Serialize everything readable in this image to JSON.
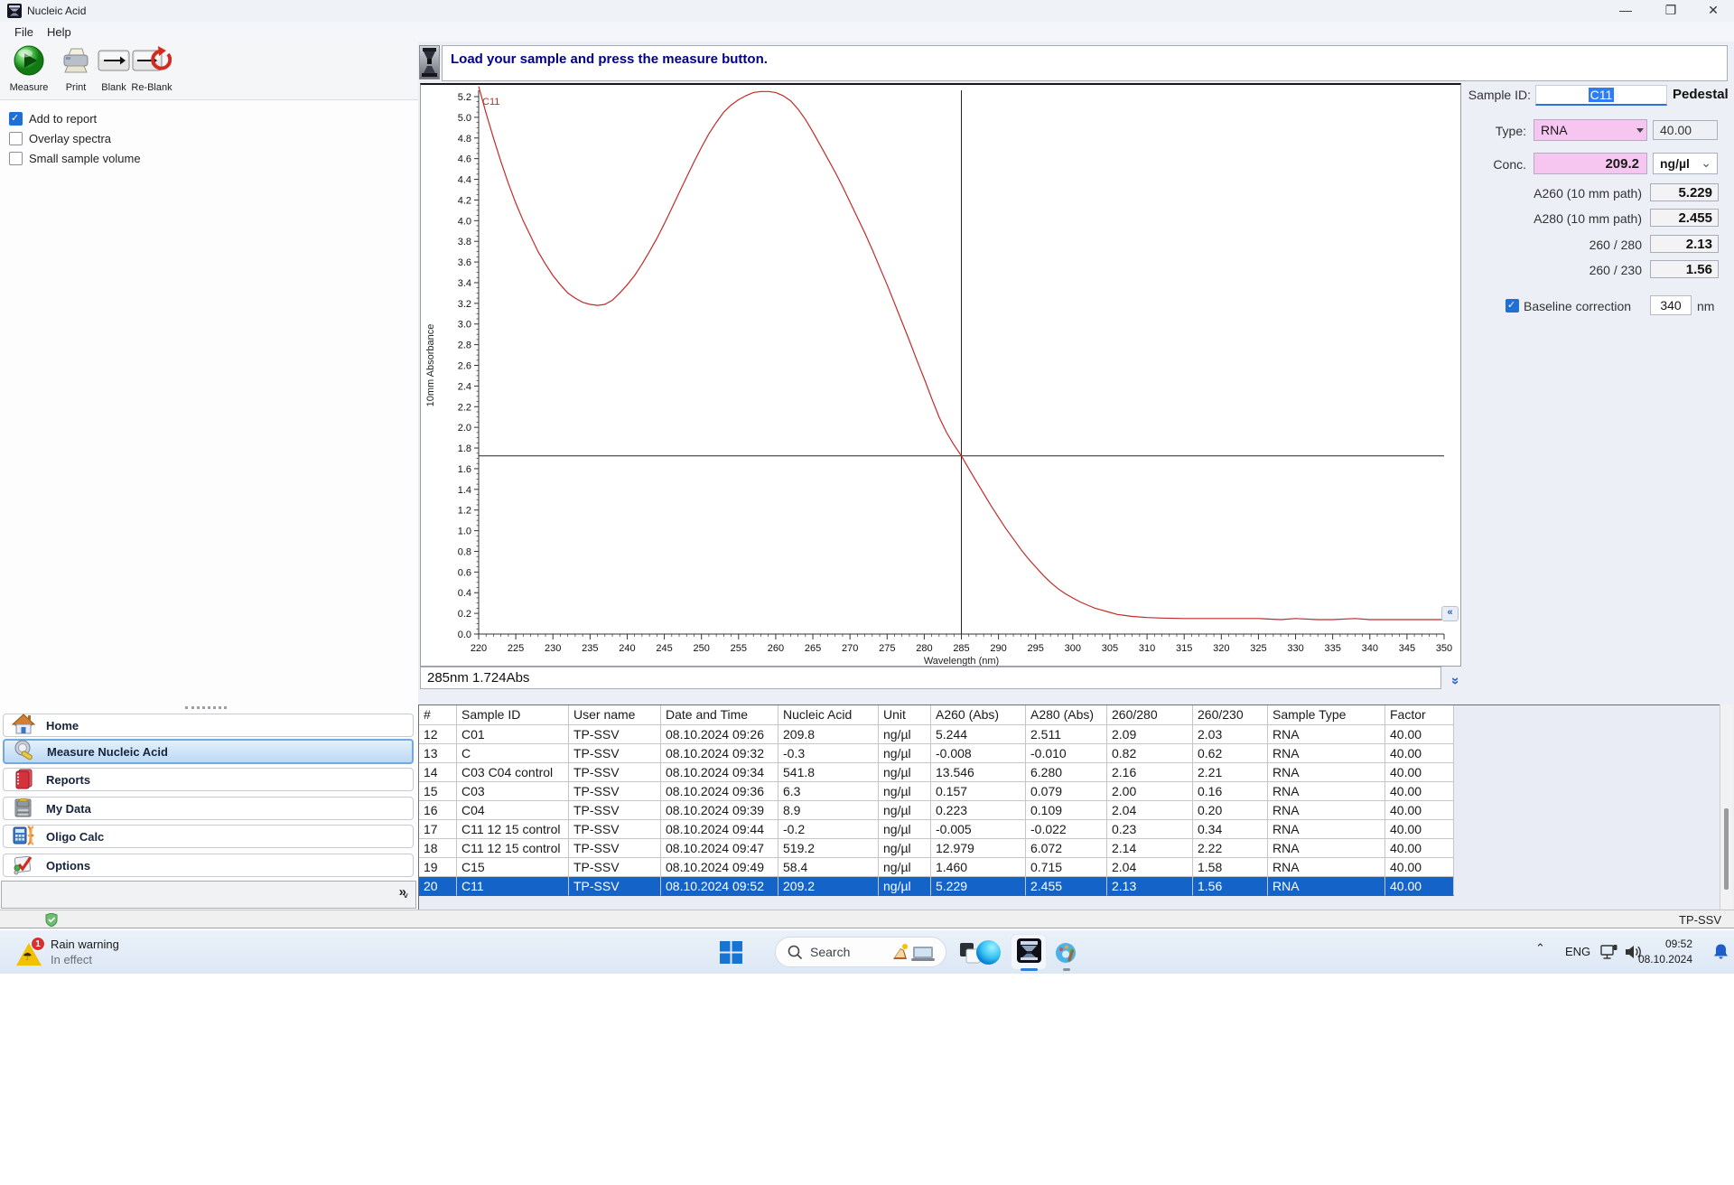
{
  "window": {
    "title": "Nucleic Acid"
  },
  "menu": {
    "items": [
      "File",
      "Help"
    ]
  },
  "toolbar": {
    "buttons": [
      {
        "label": "Measure",
        "icon": "measure-icon"
      },
      {
        "label": "Print",
        "icon": "print-icon"
      },
      {
        "label": "Blank",
        "icon": "blank-icon"
      },
      {
        "label": "Re-Blank",
        "icon": "reblank-icon"
      }
    ]
  },
  "report_options": {
    "checkboxes": [
      {
        "label": "Add to report",
        "checked": true
      },
      {
        "label": "Overlay spectra",
        "checked": false
      },
      {
        "label": "Small sample volume",
        "checked": false
      }
    ]
  },
  "status_message": "Load your sample and press the measure button.",
  "readout": "285nm 1.724Abs",
  "chart_data": {
    "type": "line",
    "xlabel": "Wavelength (nm)",
    "ylabel": "10mm Absorbance",
    "xlim": [
      220,
      350
    ],
    "ylim": [
      0,
      5.2
    ],
    "x_major_step": 5,
    "y_major_step": 0.2,
    "grid": false,
    "cursor": {
      "x": 285,
      "y": 1.724
    },
    "series": [
      {
        "name": "C11",
        "color": "#c22a2a",
        "points": [
          [
            220,
            5.3
          ],
          [
            221,
            5.04
          ],
          [
            222,
            4.8
          ],
          [
            223,
            4.57
          ],
          [
            224,
            4.36
          ],
          [
            225,
            4.17
          ],
          [
            226,
            4.0
          ],
          [
            227,
            3.85
          ],
          [
            228,
            3.7
          ],
          [
            229,
            3.58
          ],
          [
            230,
            3.47
          ],
          [
            231,
            3.38
          ],
          [
            232,
            3.3
          ],
          [
            233,
            3.25
          ],
          [
            234,
            3.21
          ],
          [
            235,
            3.19
          ],
          [
            236,
            3.18
          ],
          [
            237,
            3.19
          ],
          [
            238,
            3.23
          ],
          [
            239,
            3.3
          ],
          [
            240,
            3.38
          ],
          [
            241,
            3.47
          ],
          [
            242,
            3.58
          ],
          [
            243,
            3.7
          ],
          [
            244,
            3.83
          ],
          [
            245,
            3.97
          ],
          [
            246,
            4.12
          ],
          [
            247,
            4.27
          ],
          [
            248,
            4.42
          ],
          [
            249,
            4.57
          ],
          [
            250,
            4.71
          ],
          [
            251,
            4.84
          ],
          [
            252,
            4.95
          ],
          [
            253,
            5.05
          ],
          [
            254,
            5.12
          ],
          [
            255,
            5.17
          ],
          [
            256,
            5.21
          ],
          [
            257,
            5.24
          ],
          [
            258,
            5.25
          ],
          [
            259,
            5.25
          ],
          [
            260,
            5.24
          ],
          [
            261,
            5.21
          ],
          [
            262,
            5.16
          ],
          [
            263,
            5.08
          ],
          [
            264,
            4.98
          ],
          [
            265,
            4.86
          ],
          [
            266,
            4.73
          ],
          [
            267,
            4.6
          ],
          [
            268,
            4.47
          ],
          [
            269,
            4.33
          ],
          [
            270,
            4.18
          ],
          [
            271,
            4.03
          ],
          [
            272,
            3.88
          ],
          [
            273,
            3.72
          ],
          [
            274,
            3.55
          ],
          [
            275,
            3.38
          ],
          [
            276,
            3.2
          ],
          [
            277,
            3.02
          ],
          [
            278,
            2.84
          ],
          [
            279,
            2.65
          ],
          [
            280,
            2.47
          ],
          [
            281,
            2.28
          ],
          [
            282,
            2.1
          ],
          [
            283,
            1.95
          ],
          [
            284,
            1.83
          ],
          [
            285,
            1.724
          ],
          [
            286,
            1.6
          ],
          [
            287,
            1.48
          ],
          [
            288,
            1.36
          ],
          [
            289,
            1.24
          ],
          [
            290,
            1.13
          ],
          [
            291,
            1.02
          ],
          [
            292,
            0.92
          ],
          [
            293,
            0.82
          ],
          [
            294,
            0.73
          ],
          [
            295,
            0.65
          ],
          [
            296,
            0.57
          ],
          [
            297,
            0.5
          ],
          [
            298,
            0.44
          ],
          [
            299,
            0.39
          ],
          [
            300,
            0.35
          ],
          [
            301,
            0.31
          ],
          [
            302,
            0.28
          ],
          [
            303,
            0.25
          ],
          [
            304,
            0.23
          ],
          [
            305,
            0.21
          ],
          [
            306,
            0.19
          ],
          [
            307,
            0.18
          ],
          [
            308,
            0.17
          ],
          [
            310,
            0.16
          ],
          [
            312,
            0.155
          ],
          [
            315,
            0.15
          ],
          [
            318,
            0.15
          ],
          [
            320,
            0.15
          ],
          [
            323,
            0.15
          ],
          [
            325,
            0.15
          ],
          [
            328,
            0.14
          ],
          [
            330,
            0.15
          ],
          [
            333,
            0.14
          ],
          [
            335,
            0.14
          ],
          [
            338,
            0.15
          ],
          [
            340,
            0.14
          ],
          [
            343,
            0.14
          ],
          [
            345,
            0.14
          ],
          [
            348,
            0.14
          ],
          [
            350,
            0.14
          ]
        ]
      }
    ]
  },
  "sample_panel": {
    "sample_id_label": "Sample ID:",
    "sample_id": "C11",
    "mode": "Pedestal",
    "type_label": "Type:",
    "type_value": "RNA",
    "type_factor": "40.00",
    "conc_label": "Conc.",
    "conc_value": "209.2",
    "conc_unit": "ng/µl",
    "rows": [
      {
        "label": "A260 (10 mm path)",
        "value": "5.229"
      },
      {
        "label": "A280 (10 mm path)",
        "value": "2.455"
      },
      {
        "label": "260 / 280",
        "value": "2.13"
      },
      {
        "label": "260 / 230",
        "value": "1.56"
      }
    ],
    "baseline": {
      "label": "Baseline correction",
      "checked": true,
      "value": "340",
      "unit": "nm"
    }
  },
  "nav": {
    "items": [
      {
        "label": "Home",
        "icon": "home-icon",
        "selected": false
      },
      {
        "label": "Measure Nucleic Acid",
        "icon": "measure-nucleic-acid-icon",
        "selected": true
      },
      {
        "label": "Reports",
        "icon": "reports-icon",
        "selected": false
      },
      {
        "label": "My Data",
        "icon": "my-data-icon",
        "selected": false
      },
      {
        "label": "Oligo Calc",
        "icon": "oligo-calc-icon",
        "selected": false
      },
      {
        "label": "Options",
        "icon": "options-icon",
        "selected": false
      }
    ]
  },
  "table": {
    "columns": [
      "#",
      "Sample ID",
      "User name",
      "Date and Time",
      "Nucleic Acid",
      "Unit",
      "A260 (Abs)",
      "A280 (Abs)",
      "260/280",
      "260/230",
      "Sample Type",
      "Factor"
    ],
    "selected_index": 8,
    "rows": [
      [
        "12",
        "C01",
        "TP-SSV",
        "08.10.2024 09:26",
        "209.8",
        "ng/µl",
        "5.244",
        "2.511",
        "2.09",
        "2.03",
        "RNA",
        "40.00"
      ],
      [
        "13",
        "C",
        "TP-SSV",
        "08.10.2024 09:32",
        "-0.3",
        "ng/µl",
        "-0.008",
        "-0.010",
        "0.82",
        "0.62",
        "RNA",
        "40.00"
      ],
      [
        "14",
        "C03 C04 control",
        "TP-SSV",
        "08.10.2024 09:34",
        "541.8",
        "ng/µl",
        "13.546",
        "6.280",
        "2.16",
        "2.21",
        "RNA",
        "40.00"
      ],
      [
        "15",
        "C03",
        "TP-SSV",
        "08.10.2024 09:36",
        "6.3",
        "ng/µl",
        "0.157",
        "0.079",
        "2.00",
        "0.16",
        "RNA",
        "40.00"
      ],
      [
        "16",
        "C04",
        "TP-SSV",
        "08.10.2024 09:39",
        "8.9",
        "ng/µl",
        "0.223",
        "0.109",
        "2.04",
        "0.20",
        "RNA",
        "40.00"
      ],
      [
        "17",
        "C11 12 15 control",
        "TP-SSV",
        "08.10.2024 09:44",
        "-0.2",
        "ng/µl",
        "-0.005",
        "-0.022",
        "0.23",
        "0.34",
        "RNA",
        "40.00"
      ],
      [
        "18",
        "C11 12 15 control",
        "TP-SSV",
        "08.10.2024 09:47",
        "519.2",
        "ng/µl",
        "12.979",
        "6.072",
        "2.14",
        "2.22",
        "RNA",
        "40.00"
      ],
      [
        "19",
        "C15",
        "TP-SSV",
        "08.10.2024 09:49",
        "58.4",
        "ng/µl",
        "1.460",
        "0.715",
        "2.04",
        "1.58",
        "RNA",
        "40.00"
      ],
      [
        "20",
        "C11",
        "TP-SSV",
        "08.10.2024 09:52",
        "209.2",
        "ng/µl",
        "5.229",
        "2.455",
        "2.13",
        "1.56",
        "RNA",
        "40.00"
      ]
    ]
  },
  "app_statusbar": {
    "user": "TP-SSV"
  },
  "taskbar": {
    "weather": {
      "badge": "1",
      "title": "Rain warning",
      "subtitle": "In effect"
    },
    "search_placeholder": "Search",
    "tray": {
      "lang": "ENG",
      "time": "09:52",
      "date": "08.10.2024"
    }
  }
}
